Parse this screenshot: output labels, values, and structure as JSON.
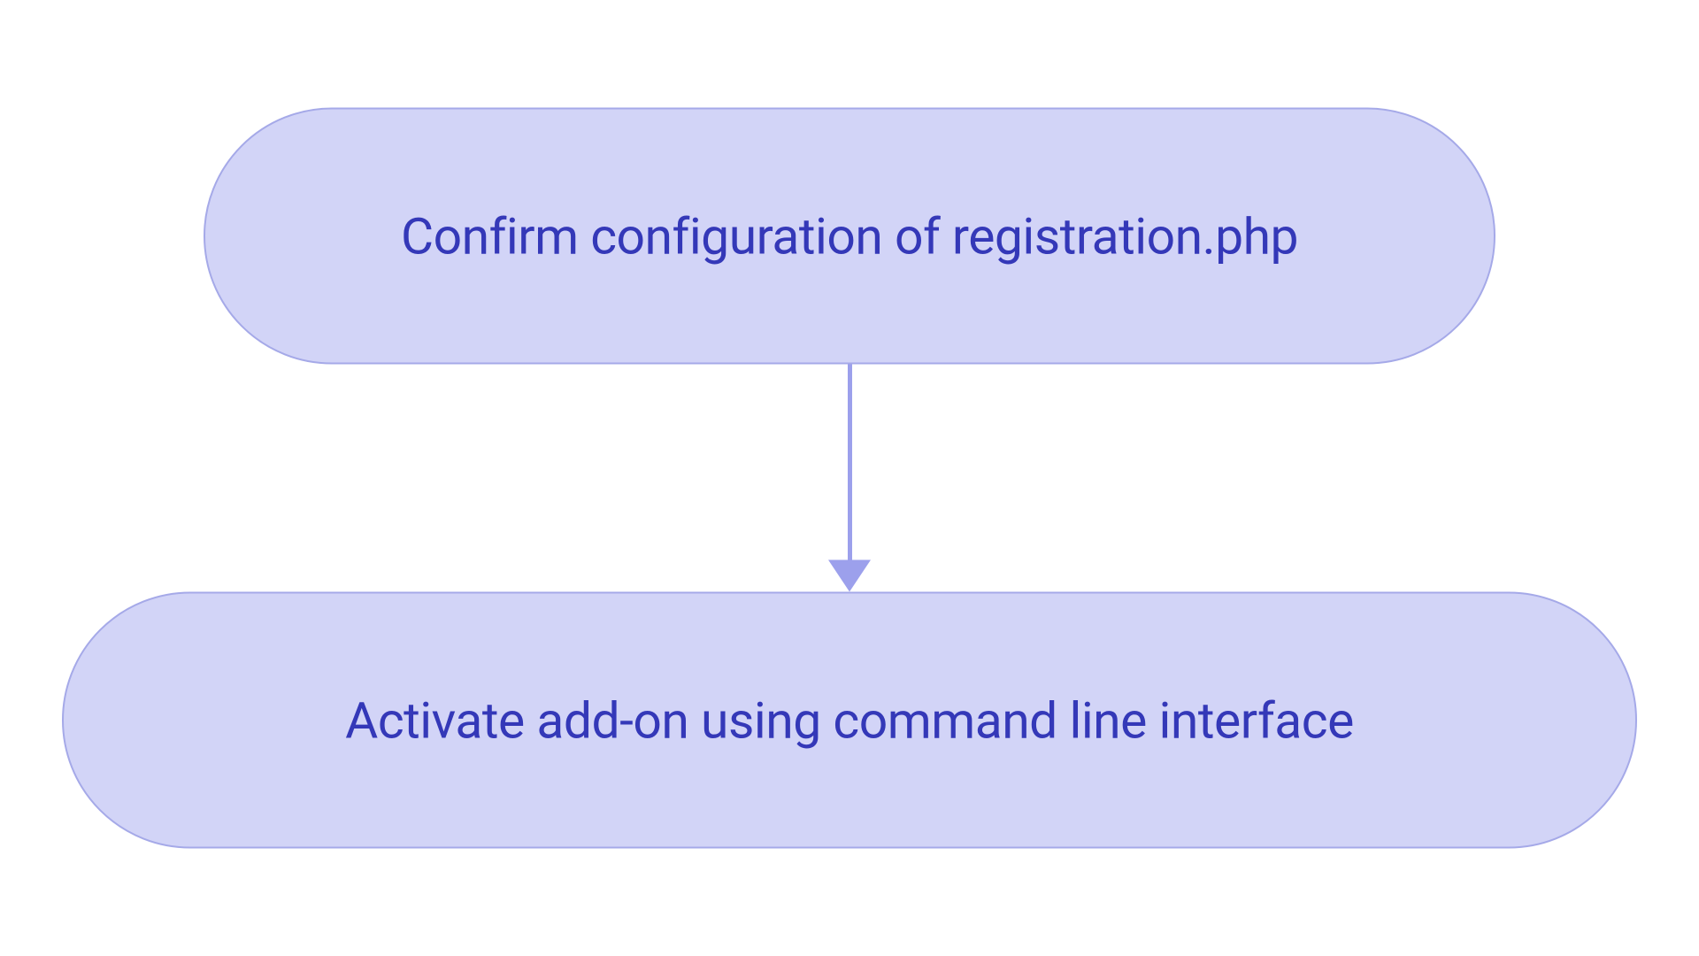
{
  "diagram": {
    "nodes": [
      {
        "id": "node-1",
        "label": "Confirm configuration of registration.php"
      },
      {
        "id": "node-2",
        "label": "Activate add-on using command line interface"
      }
    ],
    "connections": [
      {
        "from": "node-1",
        "to": "node-2",
        "type": "arrow"
      }
    ]
  },
  "colors": {
    "nodeFill": "#d2d4f7",
    "nodeBorder": "#a5a9e8",
    "nodeText": "#3438b8",
    "connector": "#9ca0ec"
  }
}
